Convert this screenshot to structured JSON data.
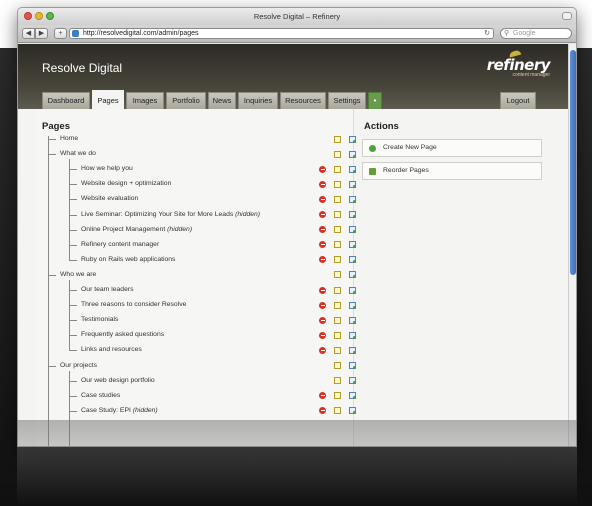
{
  "browser": {
    "window_title": "Resolve Digital – Refinery",
    "url": "http://resolvedigital.com/admin/pages",
    "search_placeholder": "Google"
  },
  "site": {
    "title": "Resolve Digital",
    "logo_word": "refinery",
    "logo_sub": "content manager"
  },
  "tabs": [
    "Dashboard",
    "Pages",
    "Images",
    "Portfolio",
    "News",
    "Inquiries",
    "Resources",
    "Settings"
  ],
  "active_tab": "Pages",
  "logout_label": "Logout",
  "pages_title": "Pages",
  "pages": [
    {
      "label": "Home",
      "level": 0,
      "hidden_note": "",
      "deletable": false
    },
    {
      "label": "What we do",
      "level": 0,
      "hidden_note": "",
      "deletable": false
    },
    {
      "label": "How we help you",
      "level": 1,
      "hidden_note": "",
      "deletable": true
    },
    {
      "label": "Website design + optimization",
      "level": 1,
      "hidden_note": "",
      "deletable": true
    },
    {
      "label": "Website evaluation",
      "level": 1,
      "hidden_note": "",
      "deletable": true
    },
    {
      "label": "Live Seminar: Optimizing Your Site for More Leads",
      "level": 1,
      "hidden_note": "(hidden)",
      "deletable": true
    },
    {
      "label": "Online Project Management",
      "level": 1,
      "hidden_note": "(hidden)",
      "deletable": true
    },
    {
      "label": "Refinery content manager",
      "level": 1,
      "hidden_note": "",
      "deletable": true
    },
    {
      "label": "Ruby on Rails web applications",
      "level": 1,
      "hidden_note": "",
      "deletable": true
    },
    {
      "label": "Who we are",
      "level": 0,
      "hidden_note": "",
      "deletable": false
    },
    {
      "label": "Our team leaders",
      "level": 1,
      "hidden_note": "",
      "deletable": true
    },
    {
      "label": "Three reasons to consider Resolve",
      "level": 1,
      "hidden_note": "",
      "deletable": true
    },
    {
      "label": "Testimonials",
      "level": 1,
      "hidden_note": "",
      "deletable": true
    },
    {
      "label": "Frequently asked questions",
      "level": 1,
      "hidden_note": "",
      "deletable": true
    },
    {
      "label": "Links and resources",
      "level": 1,
      "hidden_note": "",
      "deletable": true
    },
    {
      "label": "Our projects",
      "level": 0,
      "hidden_note": "",
      "deletable": false
    },
    {
      "label": "Our web design portfolio",
      "level": 1,
      "hidden_note": "",
      "deletable": false
    },
    {
      "label": "Case studies",
      "level": 1,
      "hidden_note": "",
      "deletable": true
    },
    {
      "label": "Case Study: EPI",
      "level": 1,
      "hidden_note": "(hidden)",
      "deletable": true
    }
  ],
  "actions_title": "Actions",
  "actions": [
    "Create New Page",
    "Reorder Pages"
  ],
  "colors": {
    "header_dark": "#2c2a24",
    "delete_red": "#d9302a",
    "add_green": "#4da23b",
    "scroll_blue": "#3f6fb9"
  }
}
